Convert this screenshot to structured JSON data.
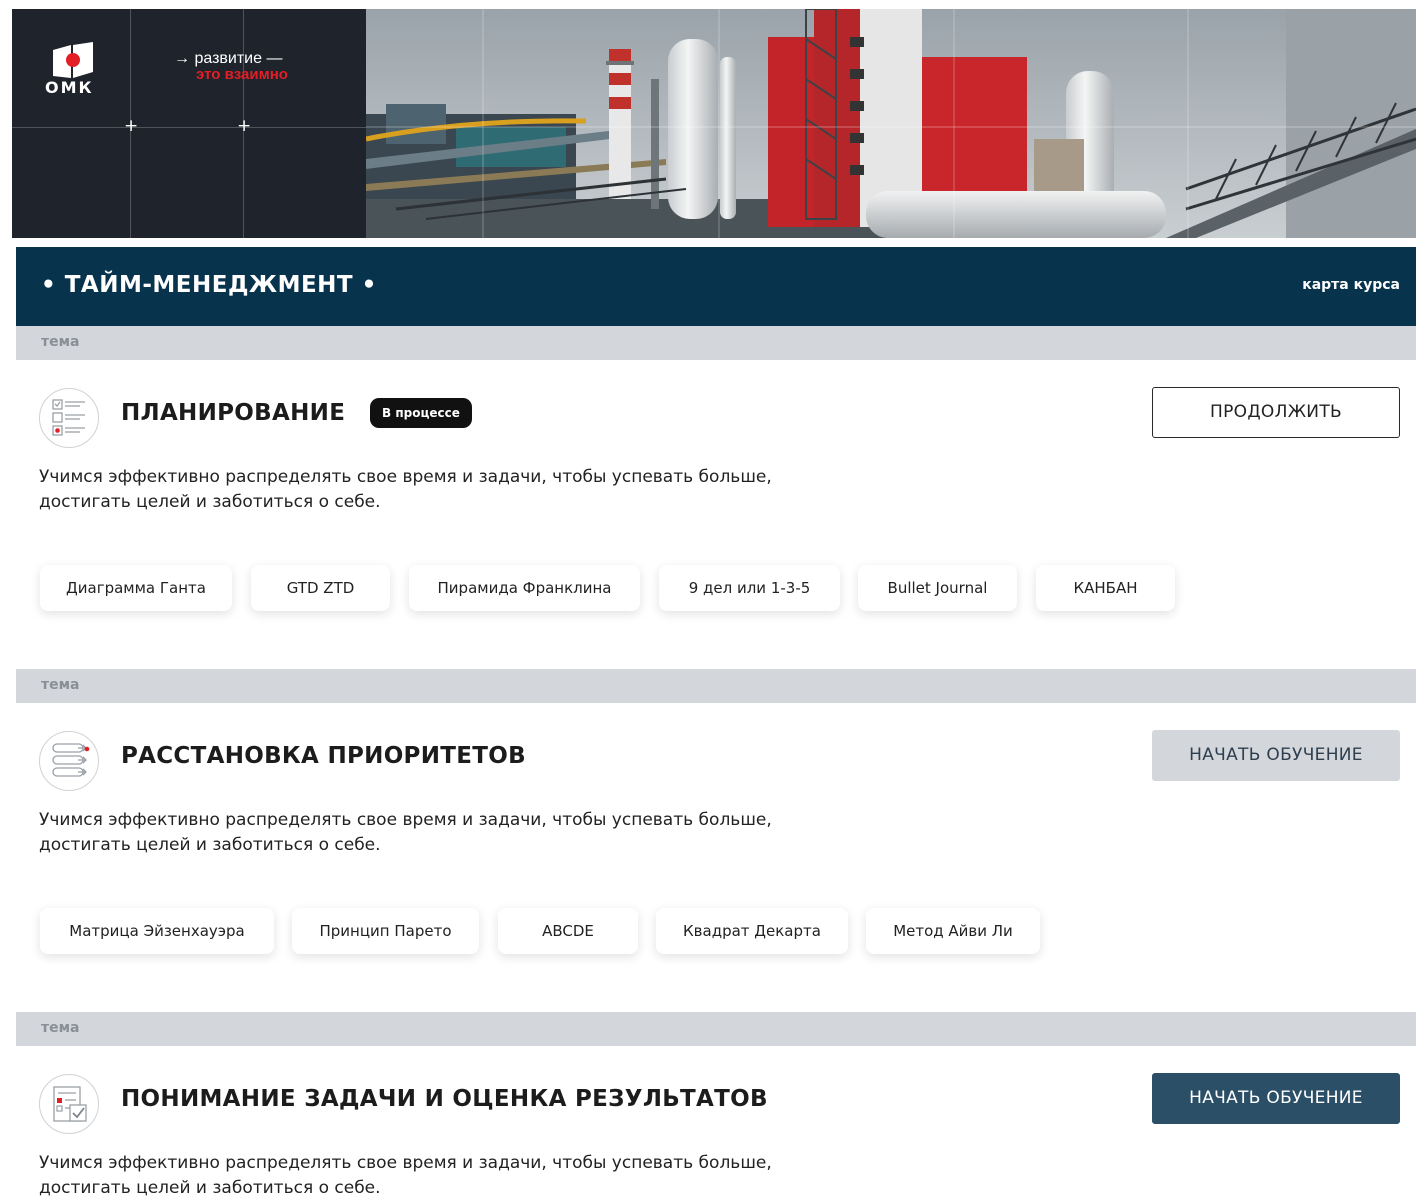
{
  "brand": {
    "logo_text": "ОМК",
    "tagline_line1": "→ развитие —",
    "tagline_line2": "это взаимно"
  },
  "course": {
    "title": "• ТАЙМ-МЕНЕДЖМЕНТ •",
    "map_link": "карта курса"
  },
  "topics": [
    {
      "label": "тема",
      "title": "ПЛАНИРОВАНИЕ",
      "status": "В процессе",
      "description_line1": "Учимся эффективно распределять свое время и задачи, чтобы успевать больше,",
      "description_line2": "достигать целей и заботиться о себе.",
      "action": "ПРОДОЛЖИТЬ",
      "icon": "checklist-icon",
      "chips": [
        "Диаграмма Ганта",
        "GTD ZTD",
        "Пирамида Франклина",
        "9 дел или 1-3-5",
        "Bullet Journal",
        "КАНБАН"
      ]
    },
    {
      "label": "тема",
      "title": "РАССТАНОВКА ПРИОРИТЕТОВ",
      "description_line1": "Учимся эффективно распределять свое время и задачи, чтобы успевать больше,",
      "description_line2": "достигать целей и заботиться о себе.",
      "action": "НАЧАТЬ ОБУЧЕНИЕ",
      "icon": "priority-list-icon",
      "chips": [
        "Матрица Эйзенхауэра",
        "Принцип Парето",
        "ABCDE",
        "Квадрат Декарта",
        "Метод Айви Ли"
      ]
    },
    {
      "label": "тема",
      "title": "ПОНИМАНИЕ ЗАДАЧИ И ОЦЕНКА РЕЗУЛЬТАТОВ",
      "description_line1": "Учимся эффективно распределять свое время и задачи, чтобы успевать больше,",
      "description_line2": "достигать целей и заботиться о себе.",
      "action": "НАЧАТЬ ОБУЧЕНИЕ",
      "icon": "task-evaluation-icon"
    }
  ],
  "colors": {
    "header_bg": "#07334d",
    "topic_bar_bg": "#d3d6db",
    "brand_red": "#e31e24",
    "button_dark": "#2b4f67"
  }
}
